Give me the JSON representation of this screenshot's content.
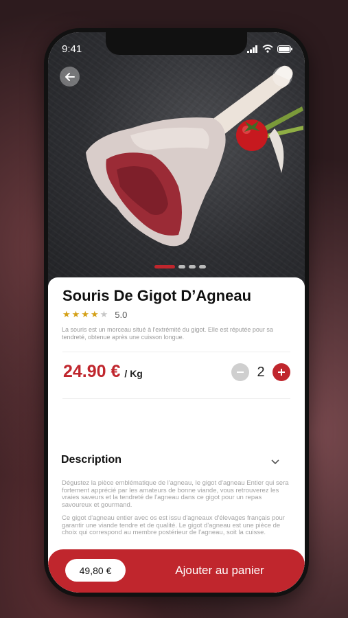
{
  "status": {
    "time": "9:41"
  },
  "product": {
    "name": "Souris De Gigot D’Agneau",
    "rating_value": "5.0",
    "rating_stars": 4,
    "intro": "La souris est un morceau situé à l'extrémité du gigot. Elle est réputée pour sa tendreté, obtenue après une cuisson longue.",
    "price": "24.90 €",
    "unit": "/ Kg",
    "quantity": "2"
  },
  "carousel": {
    "count": 4,
    "active": 0
  },
  "description": {
    "heading": "Description",
    "p1": "Dégustez la pièce emblématique de l'agneau, le gigot d'agneau Entier qui sera fortement apprécié par les amateurs de bonne viande, vous retrouverez les vraies saveurs et la tendreté de l'agneau dans ce gigot pour un repas savoureux et gourmand.",
    "p2": "Ce gigot d'agneau entier avec os est issu d'agneaux d'élevages français pour garantir une viande tendre et de qualité. Le gigot d'agneau est une pièce de choix qui correspond au membre postérieur de l'agneau, soit la cuisse."
  },
  "footer": {
    "total": "49,80 €",
    "cta": "Ajouter au panier"
  },
  "colors": {
    "accent": "#c0262d"
  }
}
